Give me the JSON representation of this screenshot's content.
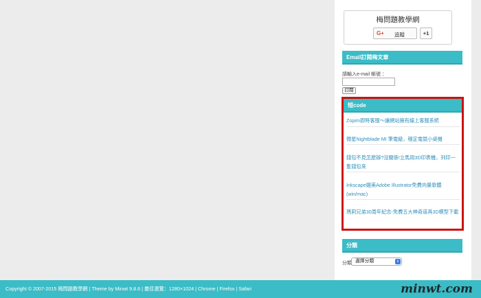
{
  "gplus": {
    "title": "梅問題教學網",
    "icon": "G+",
    "follow_label": "追蹤",
    "plusone_label": "+1"
  },
  "email_widget": {
    "header": "Email訂閱梅文章",
    "prompt": "請輸入e-mail 帳號 ：",
    "input_value": "",
    "button_label": "訂閱"
  },
  "code_widget": {
    "header": "短code",
    "items": [
      "Zopim即時客服～讓網站擁有線上客服系統",
      "微星Nightblade MI 筆電級，穩定電競小桌機",
      "錢包不見怎麼辦?沒關係!立馬用3D印表機，列印一隻錢包來",
      "Inkscape媲美Adobe Illustrator免費向量軟體(win/mac)",
      "瑪莉兄弟30周年紀念-免費五大神奇道具3D模型下載"
    ]
  },
  "category_widget": {
    "header": "分類",
    "label": "分類",
    "selected": "選擇分類"
  },
  "footer": {
    "text": "Copyright © 2007-2015 梅問題教學網 | Theme by Minwt 9.8.6 | 最佳瀏覽：1280×1024 | Chrome | Firefox | Safari"
  },
  "watermark": {
    "text": "minwt.com"
  }
}
